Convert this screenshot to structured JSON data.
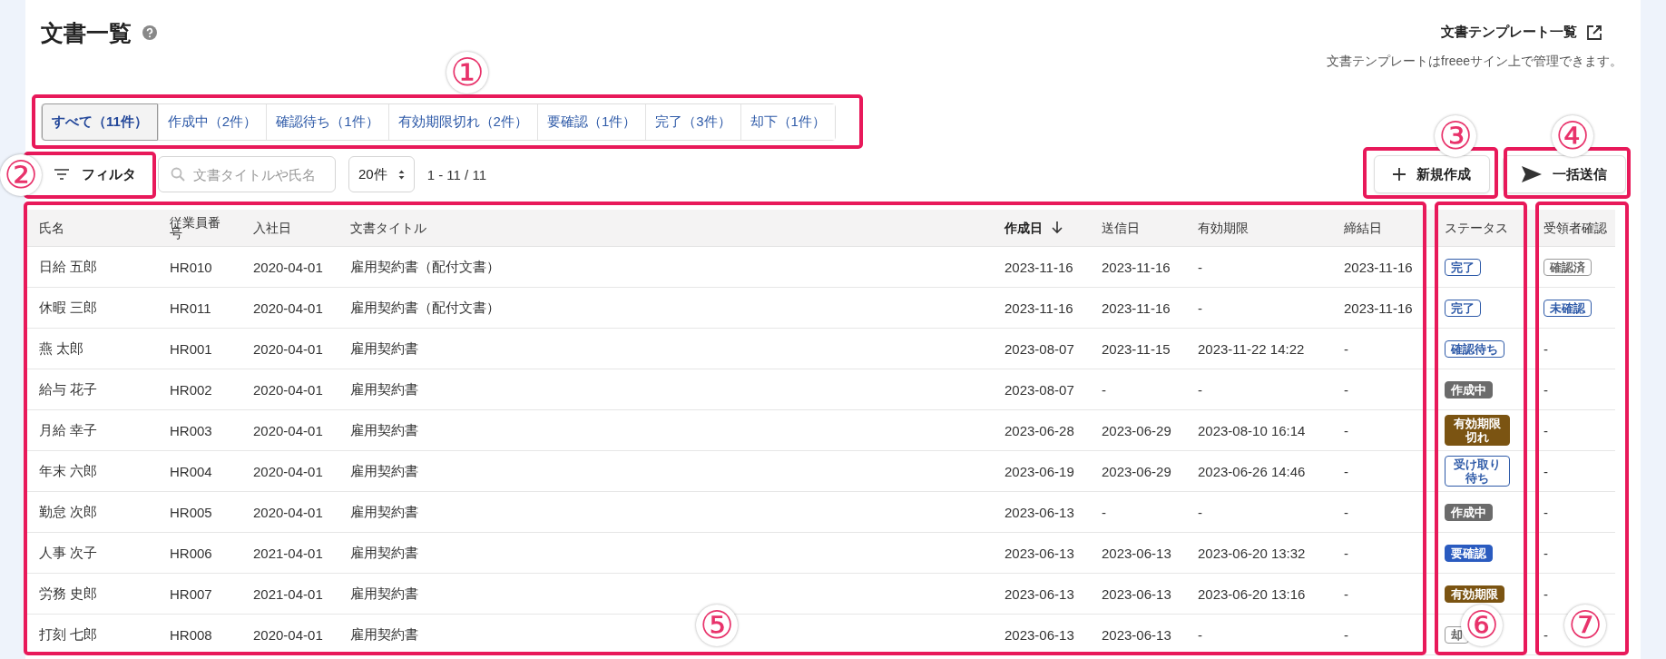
{
  "page": {
    "title": "文書一覧",
    "template_link": "文書テンプレート一覧",
    "template_note": "文書テンプレートはfreeeサイン上で管理できます。"
  },
  "tabs": [
    {
      "label": "すべて（11件）",
      "selected": true
    },
    {
      "label": "作成中（2件）",
      "selected": false
    },
    {
      "label": "確認待ち（1件）",
      "selected": false
    },
    {
      "label": "有効期限切れ（2件）",
      "selected": false
    },
    {
      "label": "要確認（1件）",
      "selected": false
    },
    {
      "label": "完了（3件）",
      "selected": false
    },
    {
      "label": "却下（1件）",
      "selected": false
    }
  ],
  "toolbar": {
    "filter_button": "フィルタ",
    "search": {
      "placeholder": "文書タイトルや氏名"
    },
    "page_size": "20件",
    "range": "1 - 11 / 11",
    "new_button": "新規作成",
    "bulk_send_button": "一括送信"
  },
  "table": {
    "columns": [
      {
        "label": "氏名",
        "sorted": false
      },
      {
        "label": "従業員番号",
        "sorted": false
      },
      {
        "label": "入社日",
        "sorted": false
      },
      {
        "label": "文書タイトル",
        "sorted": false
      },
      {
        "label": "作成日",
        "sorted": true
      },
      {
        "label": "送信日",
        "sorted": false
      },
      {
        "label": "有効期限",
        "sorted": false
      },
      {
        "label": "締結日",
        "sorted": false
      },
      {
        "label": "ステータス",
        "sorted": false
      },
      {
        "label": "受領者確認",
        "sorted": false
      }
    ],
    "rows": [
      {
        "cells": [
          "日給 五郎",
          "HR010",
          "2020-04-01",
          "雇用契約書（配付文書）",
          "2023-11-16",
          "2023-11-16",
          "-",
          "2023-11-16"
        ],
        "status": {
          "label": "完了",
          "kind": "outline"
        },
        "receipt": {
          "label": "確認済",
          "kind": "muted"
        }
      },
      {
        "cells": [
          "休暇 三郎",
          "HR011",
          "2020-04-01",
          "雇用契約書（配付文書）",
          "2023-11-16",
          "2023-11-16",
          "-",
          "2023-11-16"
        ],
        "status": {
          "label": "完了",
          "kind": "outline"
        },
        "receipt": {
          "label": "未確認",
          "kind": "outline"
        }
      },
      {
        "cells": [
          "燕 太郎",
          "HR001",
          "2020-04-01",
          "雇用契約書",
          "2023-08-07",
          "2023-11-15",
          "2023-11-22 14:22",
          "-"
        ],
        "status": {
          "label": "確認待ち",
          "kind": "outline"
        },
        "receipt": {
          "label": "-",
          "kind": "plain"
        }
      },
      {
        "cells": [
          "給与 花子",
          "HR002",
          "2020-04-01",
          "雇用契約書",
          "2023-08-07",
          "-",
          "-",
          "-"
        ],
        "status": {
          "label": "作成中",
          "kind": "gray"
        },
        "receipt": {
          "label": "-",
          "kind": "plain"
        }
      },
      {
        "cells": [
          "月給 幸子",
          "HR003",
          "2020-04-01",
          "雇用契約書",
          "2023-06-28",
          "2023-06-29",
          "2023-08-10 16:14",
          "-"
        ],
        "status": {
          "label": "有効期限切れ",
          "kind": "brown"
        },
        "receipt": {
          "label": "-",
          "kind": "plain"
        }
      },
      {
        "cells": [
          "年末 六郎",
          "HR004",
          "2020-04-01",
          "雇用契約書",
          "2023-06-19",
          "2023-06-29",
          "2023-06-26 14:46",
          "-"
        ],
        "status": {
          "label": "受け取り待ち",
          "kind": "outline"
        },
        "receipt": {
          "label": "-",
          "kind": "plain"
        }
      },
      {
        "cells": [
          "勤怠 次郎",
          "HR005",
          "2020-04-01",
          "雇用契約書",
          "2023-06-13",
          "-",
          "-",
          "-"
        ],
        "status": {
          "label": "作成中",
          "kind": "gray"
        },
        "receipt": {
          "label": "-",
          "kind": "plain"
        }
      },
      {
        "cells": [
          "人事 次子",
          "HR006",
          "2021-04-01",
          "雇用契約書",
          "2023-06-13",
          "2023-06-13",
          "2023-06-20 13:32",
          "-"
        ],
        "status": {
          "label": "要確認",
          "kind": "blue"
        },
        "receipt": {
          "label": "-",
          "kind": "plain"
        }
      },
      {
        "cells": [
          "労務 史郎",
          "HR007",
          "2021-04-01",
          "雇用契約書",
          "2023-06-13",
          "2023-06-13",
          "2023-06-20 13:16",
          "-"
        ],
        "status": {
          "label": "有効期限",
          "kind": "brown"
        },
        "receipt": {
          "label": "-",
          "kind": "plain"
        }
      },
      {
        "cells": [
          "打刻 七郎",
          "HR008",
          "2020-04-01",
          "雇用契約書",
          "2023-06-13",
          "2023-06-13",
          "-",
          "-"
        ],
        "status": {
          "label": "却",
          "kind": "muted"
        },
        "receipt": {
          "label": "-",
          "kind": "plain"
        }
      }
    ]
  },
  "callouts": [
    "①",
    "②",
    "③",
    "④",
    "⑤",
    "⑥",
    "⑦"
  ]
}
